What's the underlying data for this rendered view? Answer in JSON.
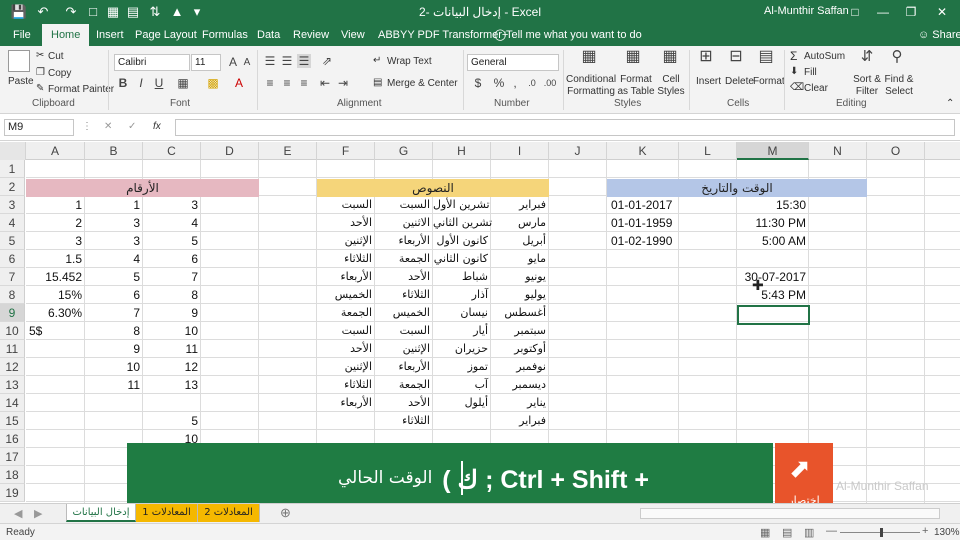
{
  "window": {
    "title": "إدخال البيانات -2 - Excel",
    "user": "Al-Munthir Saffan",
    "share_label": "Share",
    "tell_me": "Tell me what you want to do"
  },
  "tabs": [
    "File",
    "Home",
    "Insert",
    "Page Layout",
    "Formulas",
    "Data",
    "Review",
    "View",
    "ABBYY PDF Transformer+"
  ],
  "ribbon": {
    "clipboard": {
      "paste": "Paste",
      "cut": "Cut",
      "copy": "Copy",
      "format_painter": "Format Painter",
      "label": "Clipboard"
    },
    "font": {
      "name": "Calibri",
      "size": "11",
      "bold": "B",
      "italic": "I",
      "underline": "U",
      "label": "Font"
    },
    "alignment": {
      "wrap": "Wrap Text",
      "merge": "Merge & Center",
      "label": "Alignment"
    },
    "number": {
      "format": "General",
      "label": "Number"
    },
    "styles": {
      "conditional": "Conditional Formatting",
      "format_table": "Format as Table",
      "cell_styles": "Cell Styles",
      "label": "Styles"
    },
    "cells": {
      "insert": "Insert",
      "delete": "Delete",
      "format": "Format",
      "label": "Cells"
    },
    "editing": {
      "autosum": "AutoSum",
      "fill": "Fill",
      "clear": "Clear",
      "sort": "Sort & Filter",
      "find": "Find & Select",
      "label": "Editing"
    }
  },
  "formula_bar": {
    "name_box": "M9",
    "fx": "fx",
    "content": ""
  },
  "columns": [
    "A",
    "B",
    "C",
    "D",
    "E",
    "F",
    "G",
    "H",
    "I",
    "J",
    "K",
    "L",
    "M",
    "N",
    "O"
  ],
  "rows": [
    "1",
    "2",
    "3",
    "4",
    "5",
    "6",
    "7",
    "8",
    "9",
    "10",
    "11",
    "12",
    "13",
    "14",
    "15",
    "16",
    "17",
    "18",
    "19"
  ],
  "headers": {
    "numbers": "الأرقام",
    "texts": "النصوص",
    "datetime": "الوقت والتاريخ"
  },
  "grid": {
    "A": [
      "1",
      "2",
      "3",
      "1.5",
      "15.452",
      "15%",
      "6.30%",
      "5$"
    ],
    "B": [
      "1",
      "3",
      "3",
      "4",
      "5",
      "6",
      "7",
      "8",
      "9",
      "10",
      "11"
    ],
    "C": [
      "3",
      "4",
      "5",
      "6",
      "7",
      "8",
      "9",
      "10",
      "11",
      "12",
      "13",
      "",
      "5",
      "10"
    ],
    "F": [
      "السبت",
      "الأحد",
      "الإثنين",
      "الثلاثاء",
      "الأربعاء",
      "الخميس",
      "الجمعة",
      "السبت",
      "الأحد",
      "الإثنين",
      "الثلاثاء",
      "الأربعاء"
    ],
    "G": [
      "السبت",
      "الاثنين",
      "الأربعاء",
      "الجمعة",
      "الأحد",
      "الثلاثاء",
      "الخميس",
      "السبت",
      "الإثنين",
      "الأربعاء",
      "الجمعة",
      "الأحد",
      "الثلاثاء"
    ],
    "H": [
      "تشرين الأول",
      "تشرين الثاني",
      "كانون الأول",
      "كانون الثاني",
      "شباط",
      "آذار",
      "نيسان",
      "أيار",
      "حزيران",
      "تموز",
      "آب",
      "أيلول"
    ],
    "I": [
      "فبراير",
      "مارس",
      "أبريل",
      "مايو",
      "يونيو",
      "يوليو",
      "أغسطس",
      "سبتمبر",
      "أوكتوبر",
      "نوفمبر",
      "ديسمبر",
      "يناير",
      "فبراير"
    ],
    "K": [
      "01-01-2017",
      "01-01-1959",
      "01-02-1990"
    ],
    "M": [
      "15:30",
      "11:30 PM",
      "5:00 AM",
      "",
      "30-07-2017",
      "5:43 PM"
    ]
  },
  "overlay": {
    "shortcut": "( ك ;  Ctrl + Shift +",
    "description": "الوقت الحالي",
    "watermark": "Al-Munthir Saffan",
    "logo_text": "اختصار"
  },
  "sheets": [
    "إدخال البيانات",
    "المعادلات 1",
    "المعادلات 2"
  ],
  "status": {
    "ready": "Ready",
    "zoom": "130%"
  },
  "colors": {
    "excel_green": "#217346",
    "header_pink": "#e6b8c1",
    "header_yellow": "#f5d57a",
    "header_blue": "#b4c6e7",
    "overlay_green": "#1f7c43",
    "logo_orange": "#e8542b"
  }
}
